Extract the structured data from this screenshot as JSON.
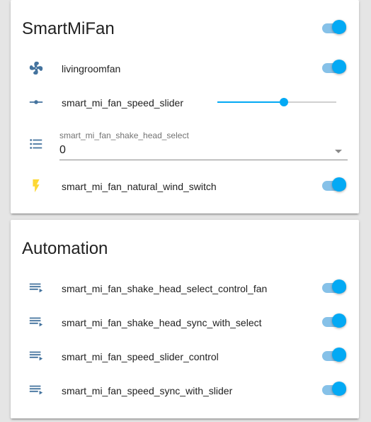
{
  "colors": {
    "accent": "#03a9f4",
    "toggle_track_on": "#86c1e8",
    "icon_blue": "#44739e",
    "bolt_yellow": "#fdd835"
  },
  "smartmifan": {
    "title": "SmartMiFan",
    "header_toggle_on": true,
    "entities": [
      {
        "icon": "fan-icon",
        "label": "livingroomfan",
        "control": "toggle",
        "on": true
      },
      {
        "icon": "ray-vertex-icon",
        "label": "smart_mi_fan_speed_slider",
        "control": "slider",
        "value_fraction": 0.56
      },
      {
        "icon": "format-list-bulleted-icon",
        "control": "select",
        "caption": "smart_mi_fan_shake_head_select",
        "value": "0"
      },
      {
        "icon": "flash-icon",
        "label": "smart_mi_fan_natural_wind_switch",
        "control": "toggle",
        "on": true
      }
    ]
  },
  "automation": {
    "title": "Automation",
    "entities": [
      {
        "icon": "playlist-play-icon",
        "label": "smart_mi_fan_shake_head_select_control_fan",
        "on": true
      },
      {
        "icon": "playlist-play-icon",
        "label": "smart_mi_fan_shake_head_sync_with_select",
        "on": true
      },
      {
        "icon": "playlist-play-icon",
        "label": "smart_mi_fan_speed_slider_control",
        "on": true
      },
      {
        "icon": "playlist-play-icon",
        "label": "smart_mi_fan_speed_sync_with_slider",
        "on": true
      }
    ]
  }
}
